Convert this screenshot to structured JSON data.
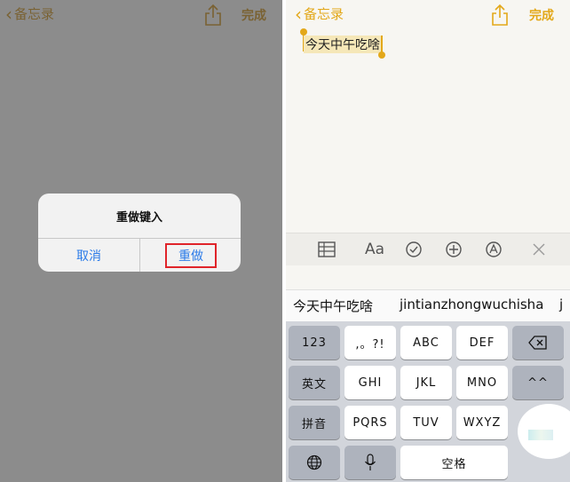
{
  "left_screen": {
    "nav": {
      "back_label": "备忘录",
      "done_label": "完成"
    },
    "alert": {
      "title": "重做键入",
      "cancel_label": "取消",
      "redo_label": "重做"
    }
  },
  "right_screen": {
    "nav": {
      "back_label": "备忘录",
      "done_label": "完成"
    },
    "note_text": "今天中午吃啥",
    "toolbar": [
      "table-icon",
      "text-format-icon",
      "checklist-icon",
      "add-icon",
      "markup-icon",
      "close-icon"
    ],
    "toolbar_text_format_label": "Aa",
    "candidates": {
      "hanzi": "今天中午吃啥",
      "pinyin": "jintianzhongwuchisha",
      "more": "j"
    },
    "keyboard": {
      "row1": [
        "123",
        ",。?!",
        "ABC",
        "DEF"
      ],
      "row2": [
        "英文",
        "GHI",
        "JKL",
        "MNO",
        "^^"
      ],
      "row3": [
        "拼音",
        "PQRS",
        "TUV",
        "WXYZ"
      ],
      "row4_space": "空格"
    }
  },
  "colors": {
    "accent": "#e3a81a",
    "link_blue": "#2b7be8",
    "highlight_red": "#e0242a"
  }
}
